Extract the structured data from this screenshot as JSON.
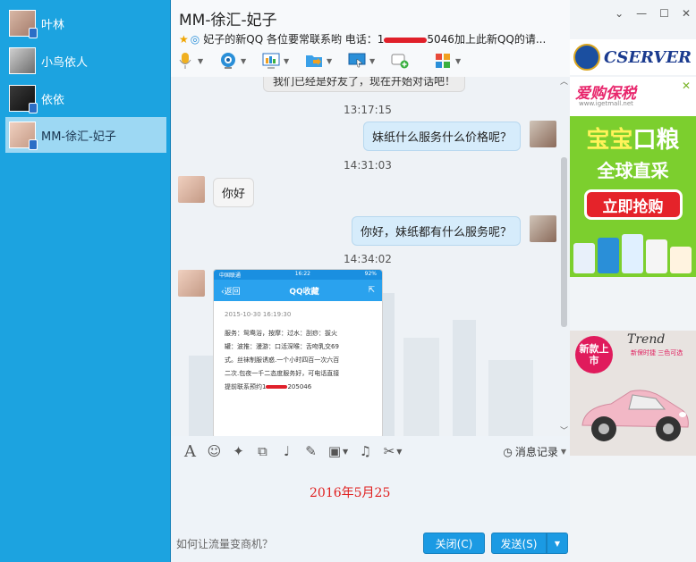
{
  "contacts": [
    {
      "name": "叶林",
      "selected": false
    },
    {
      "name": "小鸟依人",
      "selected": false
    },
    {
      "name": "依依",
      "selected": false
    },
    {
      "name": "MM-徐汇-妃子",
      "selected": true
    }
  ],
  "header": {
    "title": "MM-徐汇-妃子",
    "signature_prefix": "妃子的新QQ 各位要常联系哟  电话：1",
    "signature_suffix": "5046加上此新QQ的请..."
  },
  "toolbar_top": [
    {
      "icon": "microphone-icon"
    },
    {
      "icon": "webcam-icon"
    },
    {
      "icon": "screen-share-icon"
    },
    {
      "icon": "file-transfer-icon"
    },
    {
      "icon": "remote-desktop-icon"
    },
    {
      "icon": "invite-chat-icon"
    },
    {
      "icon": "apps-grid-icon"
    }
  ],
  "chat": {
    "top_cut_text": "我们已经是好友了，现在开始对话吧！",
    "messages": [
      {
        "time": "13:17:15",
        "side": "right",
        "text": "妹纸什么服务什么价格呢？"
      },
      {
        "time": "14:31:03",
        "side": "left",
        "text": "你好"
      },
      {
        "time": "",
        "side": "right",
        "text": "你好，妹纸都有什么服务呢？"
      },
      {
        "time": "14:34:02",
        "side": "left",
        "text": ""
      }
    ],
    "screenshot": {
      "carrier": "中国联通",
      "clock": "16:22",
      "battery": "92%",
      "back_label": "返回",
      "nav_title": "QQ收藏",
      "date": "2015-10-30 16:19:30",
      "lines": [
        "服务：鸳鸯浴，按摩：过水：刮痧：拔火",
        "罐：波推：漫游：口活深喉：舌吻乳交69",
        "式。丝袜制服诱惑.一个小时四百一次六百",
        "二次.包夜一千二态度服务好，可电话直接"
      ],
      "last_prefix": "提前联系预约1",
      "last_suffix": "205046"
    }
  },
  "input_toolbar": {
    "icons": [
      "font-icon",
      "emoji-icon",
      "magic-icon",
      "clip-icon",
      "voice-icon",
      "edit-icon",
      "image-icon",
      "music-icon",
      "screenshot-scissor-icon"
    ],
    "history_label": "消息记录"
  },
  "input": {
    "typed_text": "2016年5月25"
  },
  "footer": {
    "tip": "如何让流量变商机？",
    "close_label": "关闭(C)",
    "send_label": "发送(S)"
  },
  "ads": {
    "logo_text": "CSERVER",
    "ad1_brand": "爱购保税",
    "ad1_site": "www.igetmall.net",
    "ad1_line1_a": "宝宝",
    "ad1_line1_b": "口粮",
    "ad1_line2": "全球直采",
    "ad1_cta": "立即抢购",
    "ad2_badge": "新款上市",
    "ad2_brand": "Trend",
    "ad2_sub": "新保时捷 三色可选"
  },
  "colors": {
    "sidebar": "#1ca3e0",
    "accent": "#1b9ae3",
    "typed_text": "#e02020"
  }
}
